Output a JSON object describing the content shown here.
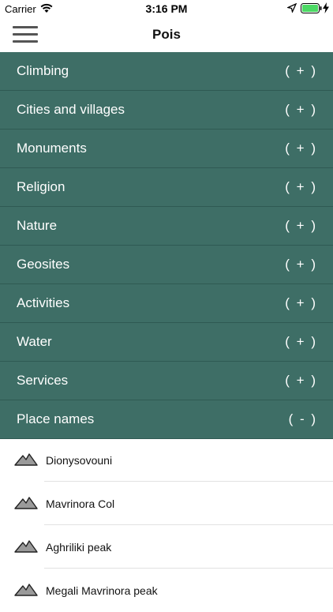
{
  "status_bar": {
    "carrier": "Carrier",
    "time": "3:16 PM"
  },
  "nav": {
    "title": "Pois"
  },
  "colors": {
    "category_bg": "#3e6e66",
    "battery": "#4cd964"
  },
  "categories": [
    {
      "label": "Climbing",
      "toggle": "( + )"
    },
    {
      "label": "Cities and villages",
      "toggle": "( + )"
    },
    {
      "label": "Monuments",
      "toggle": "( + )"
    },
    {
      "label": "Religion",
      "toggle": "( + )"
    },
    {
      "label": "Nature",
      "toggle": "( + )"
    },
    {
      "label": "Geosites",
      "toggle": "( + )"
    },
    {
      "label": "Activities",
      "toggle": "( + )"
    },
    {
      "label": "Water",
      "toggle": "( + )"
    },
    {
      "label": "Services",
      "toggle": "( + )"
    },
    {
      "label": "Place names",
      "toggle": "( - )"
    }
  ],
  "places": [
    {
      "label": "Dionysovouni",
      "icon": "mountain-icon"
    },
    {
      "label": "Mavrinora Col",
      "icon": "mountain-icon"
    },
    {
      "label": "Aghriliki peak",
      "icon": "mountain-icon"
    },
    {
      "label": "Megali Mavrinora peak",
      "icon": "mountain-icon"
    }
  ]
}
